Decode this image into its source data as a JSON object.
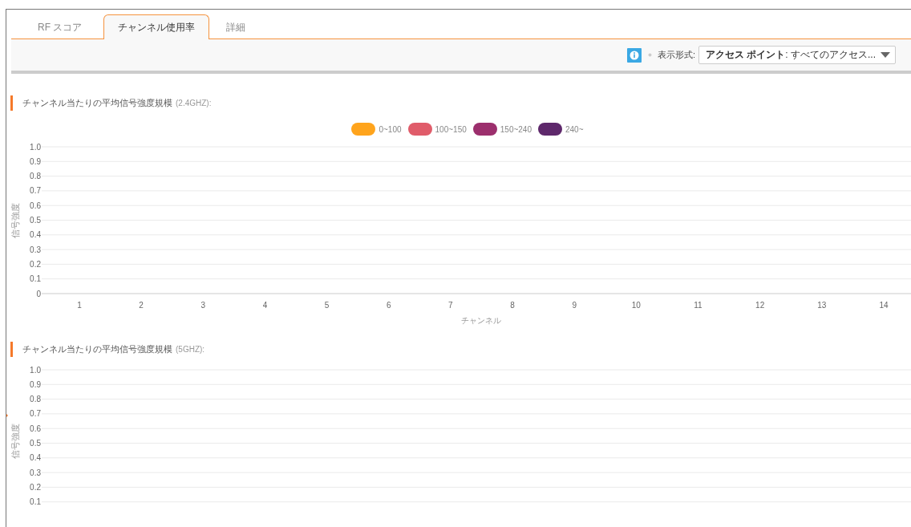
{
  "tabs": [
    {
      "label": "RF スコア",
      "selected": false
    },
    {
      "label": "チャンネル使用率",
      "selected": true
    },
    {
      "label": "詳細",
      "selected": false
    }
  ],
  "toolbar": {
    "view_label": "表示形式:",
    "view_select": {
      "value": "**アクセス ポイント**: すべてのアクセス..."
    }
  },
  "charts": [
    {
      "title": "チャンネル当たりの平均信号強度規模",
      "band": "(2.4GHZ):",
      "chart_data": {
        "type": "bar",
        "grid": true,
        "xlabel": "チャンネル",
        "ylabel": "信号強度",
        "categories": [
          "1",
          "2",
          "3",
          "4",
          "5",
          "6",
          "7",
          "8",
          "9",
          "10",
          "11",
          "12",
          "13",
          "14"
        ],
        "ylim": [
          0,
          1
        ],
        "yticks": [
          0,
          0.1,
          0.2,
          0.3,
          0.4,
          0.5,
          0.6,
          0.7,
          0.8,
          0.9,
          {
            "value": 1,
            "label": "1.0"
          }
        ],
        "series": [
          {
            "name": "0~100",
            "color": "#ffa41c",
            "values": [
              null,
              null,
              null,
              null,
              null,
              null,
              null,
              null,
              null,
              null,
              null,
              null,
              null,
              null
            ]
          },
          {
            "name": "100~150",
            "color": "#e05c6a",
            "values": [
              null,
              null,
              null,
              null,
              null,
              null,
              null,
              null,
              null,
              null,
              null,
              null,
              null,
              null
            ]
          },
          {
            "name": "150~240",
            "color": "#9c2f6d",
            "values": [
              null,
              null,
              null,
              null,
              null,
              null,
              null,
              null,
              null,
              null,
              null,
              null,
              null,
              null
            ]
          },
          {
            "name": "240~",
            "color": "#5e286b",
            "values": [
              null,
              null,
              null,
              null,
              null,
              null,
              null,
              null,
              null,
              null,
              null,
              null,
              null,
              null
            ]
          }
        ]
      }
    },
    {
      "title": "チャンネル当たりの平均信号強度規模",
      "band": "(5GHZ):",
      "chart_data": {
        "type": "bar",
        "grid": true,
        "categories": [
          null
        ],
        "ylabel": "信号強度",
        "ylim": [
          0.1,
          1
        ],
        "yticks": [
          0.1,
          0.2,
          0.3,
          0.4,
          0.5,
          0.6,
          0.7,
          0.8,
          0.9,
          {
            "value": 1,
            "label": "1.0"
          }
        ]
      }
    }
  ]
}
